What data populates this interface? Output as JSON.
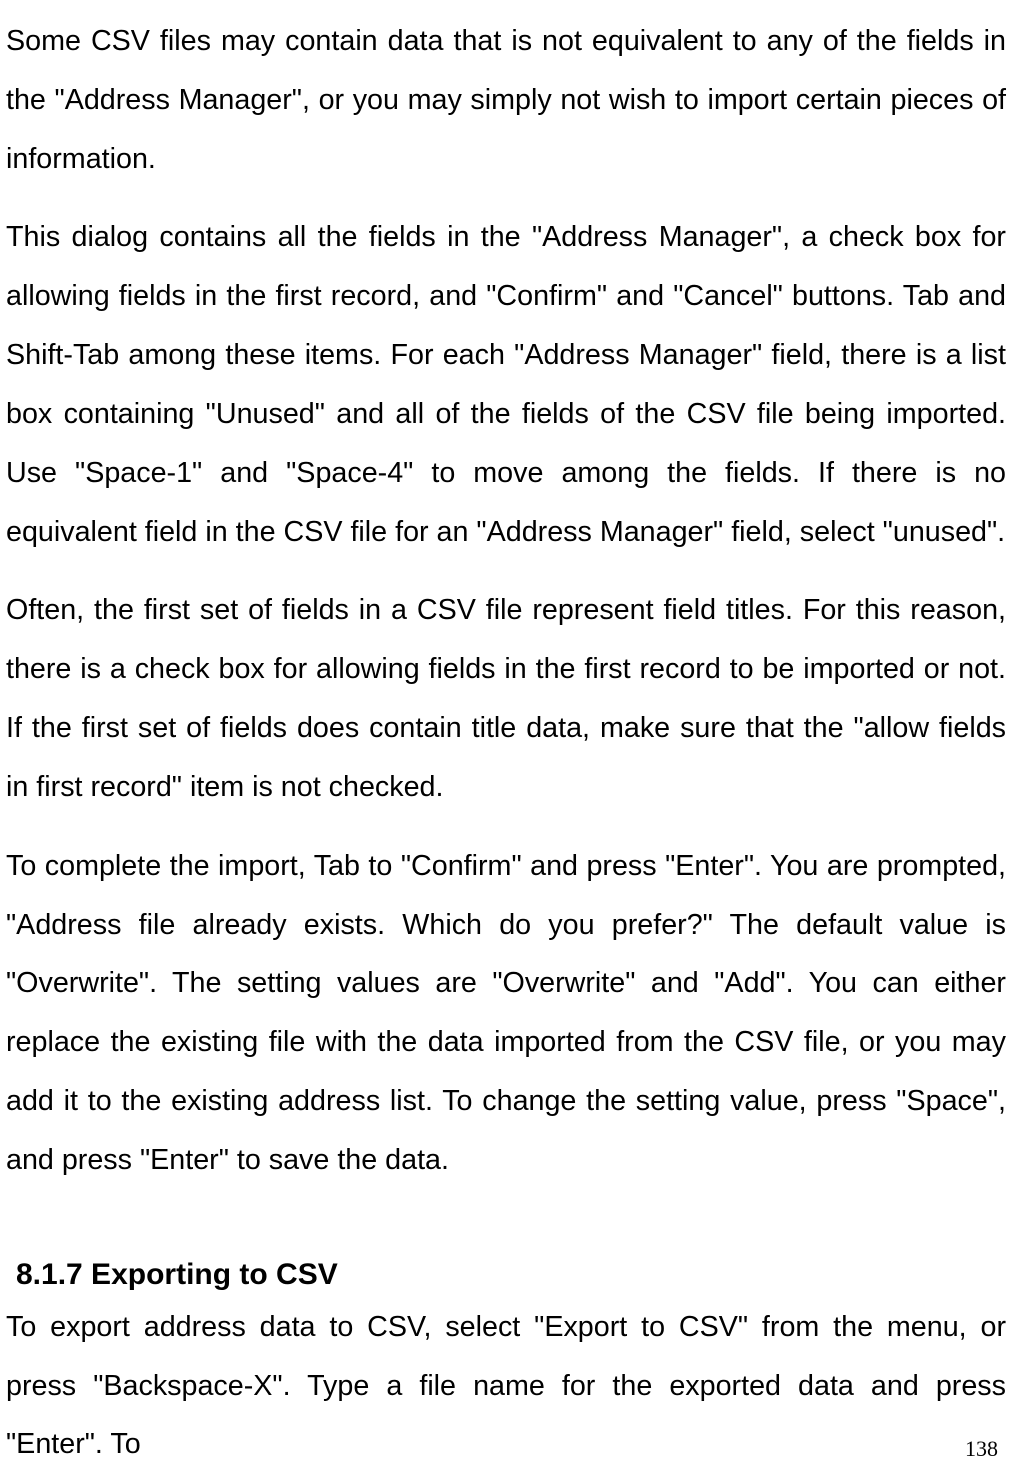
{
  "paragraphs": {
    "p1": "Some CSV files may contain data that is not equivalent to any of the fields in the \"Address Manager\", or you may simply not wish to import certain pieces of information.",
    "p2": "This dialog contains all the fields in the \"Address Manager\", a check box for allowing fields in the first record, and \"Confirm\" and \"Cancel\" buttons. Tab and Shift-Tab among these items.  For each \"Address Manager\" field, there is a list box containing \"Unused\" and all of the fields of the CSV file being imported. Use \"Space-1\" and \"Space-4\" to move among the fields. If there is no equivalent field in the CSV file for an \"Address Manager\" field, select \"unused\".",
    "p3": "Often, the first set of fields in a CSV file represent field titles. For this reason, there is a check box for allowing fields in the first record to be imported or not. If the first set of fields does contain title data, make sure that the \"allow fields in first record\" item is not checked.",
    "p4": "To complete the import, Tab to \"Confirm\" and press \"Enter\". You are prompted, \"Address file already exists. Which do you prefer?\" The default value is \"Overwrite\". The setting values are \"Overwrite\" and \"Add\". You can either replace the existing file with the data imported from the CSV file, or you may add it to the existing address list. To change the setting value, press \"Space\", and press \"Enter\" to save the data.",
    "p5": "To export address data to CSV, select \"Export to CSV\" from the menu, or press \"Backspace-X\". Type a file name for the exported data and press \"Enter\". To"
  },
  "heading": "8.1.7 Exporting to CSV",
  "page_number": "138"
}
